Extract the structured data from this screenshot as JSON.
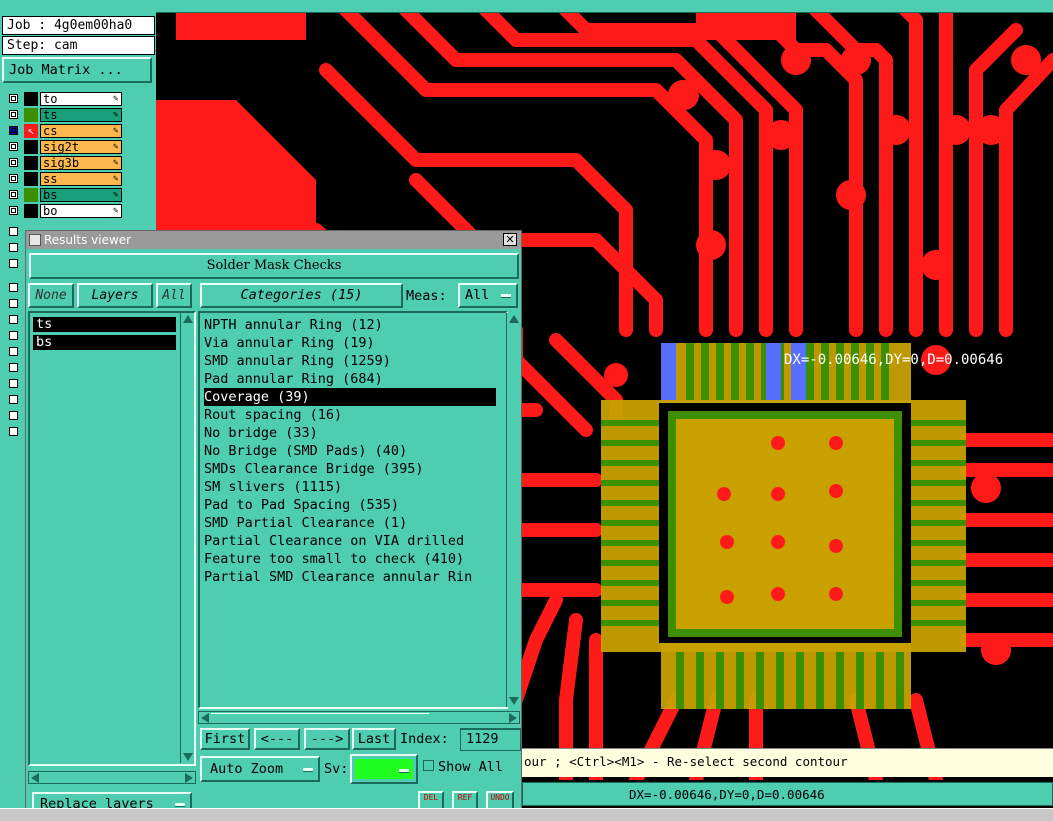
{
  "job": {
    "label": "Job : 4g0em00ha0",
    "step": "Step: cam",
    "matrix_button": "Job Matrix ..."
  },
  "layers": [
    {
      "name": "to",
      "color": "#ffffff"
    },
    {
      "name": "ts",
      "color": "#19a07a"
    },
    {
      "name": "cs",
      "color": "#ffb84d"
    },
    {
      "name": "sig2t",
      "color": "#ffb84d"
    },
    {
      "name": "sig3b",
      "color": "#ffb84d"
    },
    {
      "name": "ss",
      "color": "#ffb84d"
    },
    {
      "name": "bs",
      "color": "#19a07a"
    },
    {
      "name": "bo",
      "color": "#ffffff"
    }
  ],
  "results_viewer": {
    "title": "Results viewer",
    "header": "Solder Mask Checks",
    "none_btn": "None",
    "layers_btn": "Layers",
    "all_btn": "All",
    "categories_btn": "Categories (15)",
    "meas_label": "Meas:",
    "meas_value": "All",
    "layer_list": [
      "ts",
      "bs"
    ],
    "categories": [
      "NPTH annular Ring (12)",
      "Via annular Ring (19)",
      "SMD annular Ring (1259)",
      "Pad annular Ring (684)",
      "Coverage (39)",
      "Rout spacing (16)",
      "No bridge (33)",
      "No Bridge (SMD Pads) (40)",
      "SMDs Clearance Bridge (395)",
      "SM slivers (1115)",
      "Pad to Pad Spacing (535)",
      "SMD Partial Clearance (1)",
      "Partial Clearance on VIA drilled",
      "Feature too small to check (410)",
      "Partial SMD Clearance annular Rin"
    ],
    "selected_category": "Coverage (39)",
    "nav": {
      "first": "First",
      "prev": "<---",
      "next": "--->",
      "last": "Last",
      "index_label": "Index:",
      "index_value": "1129"
    },
    "auto_zoom": "Auto Zoom",
    "sv_label": "Sv:",
    "show_all": "Show All",
    "replace_layers": "Replace layers",
    "icons": {
      "del": "DEL",
      "ref": "REF",
      "undo": "UNDO"
    }
  },
  "measure_overlay": "DX=-0.00646,DY=0,D=0.00646",
  "status_bar": {
    "hint": "our ; <Ctrl><M1> - Re-select second contour",
    "measure": "DX=-0.00646,DY=0,D=0.00646"
  },
  "colors": {
    "panel": "#4fcdb0",
    "copper": "#ff1a1a",
    "mask": "#c8a000",
    "pad_green": "#3c9000",
    "selected_bg": "#000000"
  }
}
